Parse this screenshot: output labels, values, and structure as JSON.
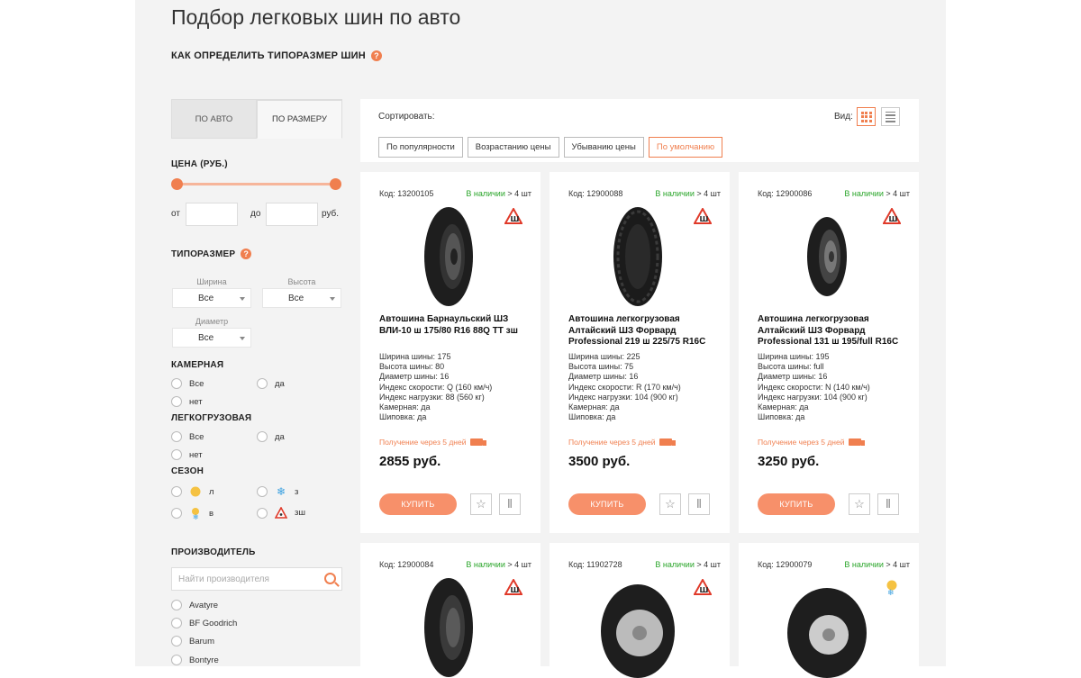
{
  "page": {
    "title": "Подбор легковых шин по авто",
    "howto": "КАК ОПРЕДЕЛИТЬ ТИПОРАЗМЕР ШИН",
    "help_glyph": "?"
  },
  "colors": {
    "accent": "#f07f4f",
    "available": "#2aa52a",
    "page_bg": "#f3f3f3"
  },
  "sidebar": {
    "tabs": [
      {
        "label": "ПО АВТО",
        "active": false
      },
      {
        "label": "ПО РАЗМЕРУ",
        "active": true
      }
    ],
    "price": {
      "heading": "ЦЕНА (РУБ.)",
      "from_label": "от",
      "to_label": "до",
      "unit": "руб.",
      "from_value": "",
      "to_value": ""
    },
    "size": {
      "heading": "ТИПОРАЗМЕР",
      "width": {
        "label": "Ширина",
        "value": "Все"
      },
      "height": {
        "label": "Высота",
        "value": "Все"
      },
      "diameter": {
        "label": "Диаметр",
        "value": "Все"
      }
    },
    "tube": {
      "heading": "КАМЕРНАЯ",
      "options": [
        "Все",
        "да",
        "нет"
      ]
    },
    "light_truck": {
      "heading": "ЛЕГКОГРУЗОВАЯ",
      "options": [
        "Все",
        "да",
        "нет"
      ]
    },
    "season": {
      "heading": "СЕЗОН",
      "options": [
        {
          "label": "л",
          "icon": "sun-icon"
        },
        {
          "label": "з",
          "icon": "snowflake-icon"
        },
        {
          "label": "в",
          "icon": "sun-snow-icon"
        },
        {
          "label": "зш",
          "icon": "studded-warning-icon"
        }
      ]
    },
    "manufacturer": {
      "heading": "ПРОИЗВОДИТЕЛЬ",
      "search_placeholder": "Найти производителя",
      "items": [
        "Avatyre",
        "BF Goodrich",
        "Barum",
        "Bontyre"
      ]
    }
  },
  "sort": {
    "label": "Сортировать:",
    "view_label": "Вид:",
    "options": [
      {
        "label": "По популярности",
        "active": false
      },
      {
        "label": "Возрастанию цены",
        "active": false
      },
      {
        "label": "Убыванию цены",
        "active": false
      },
      {
        "label": "По умолчанию",
        "active": true
      }
    ]
  },
  "products": [
    {
      "code": "Код: 13200105",
      "avail": "В наличии",
      "qty": "> 4 шт",
      "name": "Автошина Барнаульский ШЗ ВЛИ-10 ш 175/80 R16 88Q ТТ зш",
      "specs": [
        "Ширина шины: 175",
        "Высота шины: 80",
        "Диаметр шины: 16",
        "Индекс скорости: Q (160 км/ч)",
        "Индекс нагрузки: 88 (560 кг)",
        "Камерная: да",
        "Шиповка: да"
      ],
      "delivery": "Получение через 5 дней",
      "price": "2855 руб.",
      "buy": "КУПИТЬ"
    },
    {
      "code": "Код: 12900088",
      "avail": "В наличии",
      "qty": "> 4 шт",
      "name": "Автошина легкогрузовая Алтайский ШЗ Форвард Professional 219 ш 225/75 R16C",
      "specs": [
        "Ширина шины: 225",
        "Высота шины: 75",
        "Диаметр шины: 16",
        "Индекс скорости: R (170 км/ч)",
        "Индекс нагрузки: 104 (900 кг)",
        "Камерная: да",
        "Шиповка: да"
      ],
      "delivery": "Получение через 5 дней",
      "price": "3500 руб.",
      "buy": "КУПИТЬ"
    },
    {
      "code": "Код: 12900086",
      "avail": "В наличии",
      "qty": "> 4 шт",
      "name": "Автошина легкогрузовая Алтайский ШЗ Форвард Professional 131 ш 195/full R16C",
      "specs": [
        "Ширина шины: 195",
        "Высота шины: full",
        "Диаметр шины: 16",
        "Индекс скорости: N (140 км/ч)",
        "Индекс нагрузки: 104 (900 кг)",
        "Камерная: да",
        "Шиповка: да"
      ],
      "delivery": "Получение через 5 дней",
      "price": "3250 руб.",
      "buy": "КУПИТЬ"
    },
    {
      "code": "Код: 12900084",
      "avail": "В наличии",
      "qty": "> 4 шт"
    },
    {
      "code": "Код: 11902728",
      "avail": "В наличии",
      "qty": "> 4 шт"
    },
    {
      "code": "Код: 12900079",
      "avail": "В наличии",
      "qty": "> 4 шт"
    }
  ]
}
